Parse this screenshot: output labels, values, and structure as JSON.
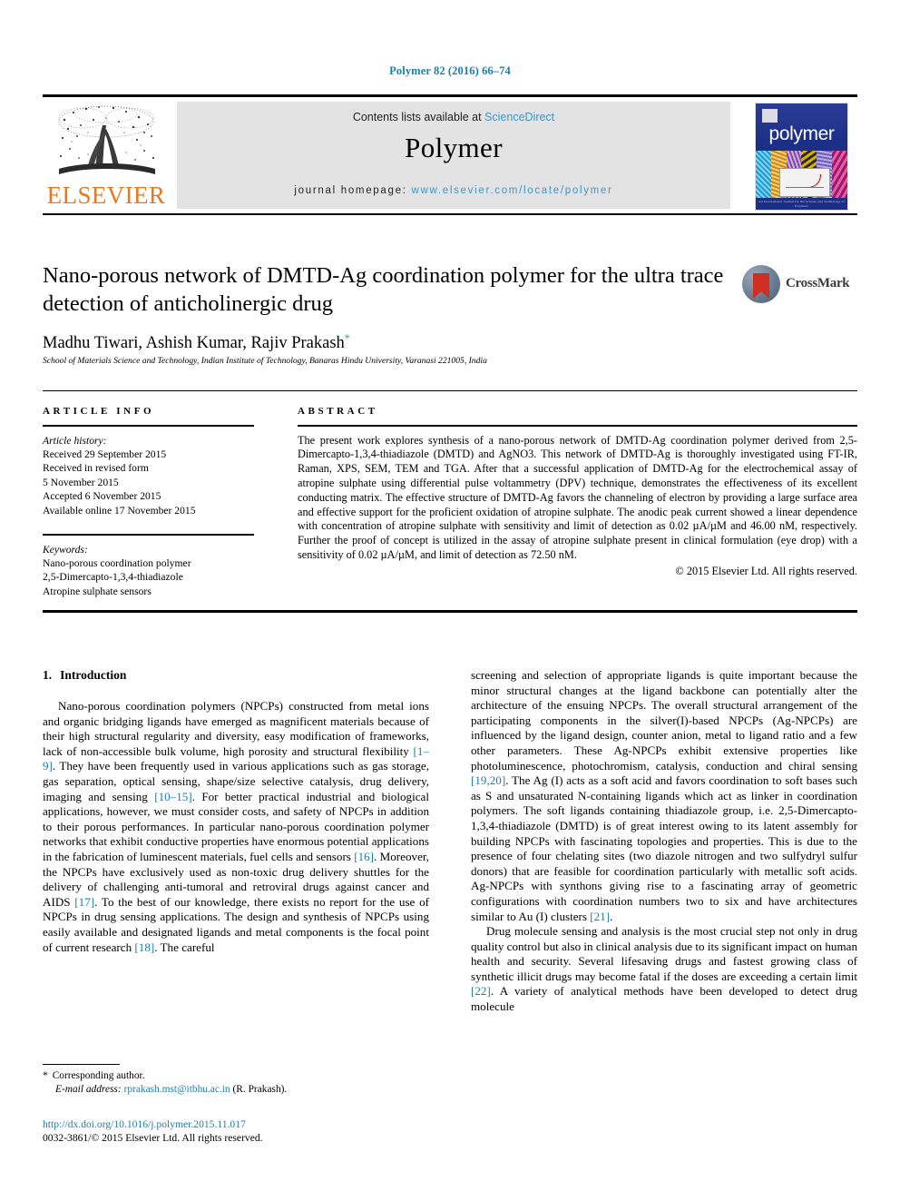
{
  "running_head": "Polymer 82 (2016) 66–74",
  "masthead": {
    "publisher_name": "ELSEVIER",
    "contents_prefix": "Contents lists available at ",
    "contents_link": "ScienceDirect",
    "journal_name": "Polymer",
    "homepage_prefix": "journal homepage: ",
    "homepage_url": "www.elsevier.com/locate/polymer",
    "cover_title": "polymer",
    "cover_footer": "An International Journal for the\nScience and Technology of Polymers"
  },
  "article": {
    "title": "Nano-porous network of DMTD-Ag coordination polymer for the ultra trace detection of anticholinergic drug",
    "authors": "Madhu Tiwari, Ashish Kumar, Rajiv Prakash",
    "author_star": "*",
    "affiliation": "School of Materials Science and Technology, Indian Institute of Technology, Banaras Hindu University, Varanasi 221005, India",
    "crossmark_label": "CrossMark"
  },
  "article_info": {
    "heading": "ARTICLE INFO",
    "history_label": "Article history:",
    "history": [
      "Received 29 September 2015",
      "Received in revised form",
      "5 November 2015",
      "Accepted 6 November 2015",
      "Available online 17 November 2015"
    ],
    "keywords_label": "Keywords:",
    "keywords": [
      "Nano-porous coordination polymer",
      "2,5-Dimercapto-1,3,4-thiadiazole",
      "Atropine sulphate sensors"
    ]
  },
  "abstract": {
    "heading": "ABSTRACT",
    "text": "The present work explores synthesis of a nano-porous network of DMTD-Ag coordination polymer derived from 2,5-Dimercapto-1,3,4-thiadiazole (DMTD) and AgNO3. This network of DMTD-Ag is thoroughly investigated using FT-IR, Raman, XPS, SEM, TEM and TGA. After that a successful application of DMTD-Ag for the electrochemical assay of atropine sulphate using differential pulse voltammetry (DPV) technique, demonstrates the effectiveness of its excellent conducting matrix. The effective structure of DMTD-Ag favors the channeling of electron by providing a large surface area and effective support for the proficient oxidation of atropine sulphate. The anodic peak current showed a linear dependence with concentration of atropine sulphate with sensitivity and limit of detection as 0.02 µA/µM and 46.00 nM, respectively. Further the proof of concept is utilized in the assay of atropine sulphate present in clinical formulation (eye drop) with a sensitivity of 0.02 µA/µM, and limit of detection as 72.50 nM.",
    "copyright": "© 2015 Elsevier Ltd. All rights reserved."
  },
  "body": {
    "section_number": "1.",
    "section_title": "Introduction",
    "left_paragraph_1": "Nano-porous coordination polymers (NPCPs) constructed from metal ions and organic bridging ligands have emerged as magnificent materials because of their high structural regularity and diversity, easy modification of frameworks, lack of non-accessible bulk volume, high porosity and structural flexibility ",
    "left_ref_1": "[1–9]",
    "left_paragraph_1b": ". They have been frequently used in various applications such as gas storage, gas separation, optical sensing, shape/size selective catalysis, drug delivery, imaging and sensing ",
    "left_ref_2": "[10–15]",
    "left_paragraph_1c": ". For better practical industrial and biological applications, however, we must consider costs, and safety of NPCPs in addition to their porous performances. In particular nano-porous coordination polymer networks that exhibit conductive properties have enormous potential applications in the fabrication of luminescent materials, fuel cells and sensors ",
    "left_ref_3": "[16]",
    "left_paragraph_1d": ". Moreover, the NPCPs have exclusively used as non-toxic drug delivery shuttles for the delivery of challenging anti-tumoral and retroviral drugs against cancer and AIDS ",
    "left_ref_4": "[17]",
    "left_paragraph_1e": ". To the best of our knowledge, there exists no report for the use of NPCPs in drug sensing applications. The design and synthesis of NPCPs using easily available and designated ligands and metal components is the focal point of current research ",
    "left_ref_5": "[18]",
    "left_paragraph_1f": ". The careful",
    "right_paragraph_1": "screening and selection of appropriate ligands is quite important because the minor structural changes at the ligand backbone can potentially alter the architecture of the ensuing NPCPs. The overall structural arrangement of the participating components in the silver(I)-based NPCPs (Ag-NPCPs) are influenced by the ligand design, counter anion, metal to ligand ratio and a few other parameters. These Ag-NPCPs exhibit extensive properties like photoluminescence, photochromism, catalysis, conduction and chiral sensing ",
    "right_ref_1": "[19,20]",
    "right_paragraph_1b": ". The Ag (I) acts as a soft acid and favors coordination to soft bases such as S and unsaturated N-containing ligands which act as linker in coordination polymers. The soft ligands containing thiadiazole group, i.e. 2,5-Dimercapto-1,3,4-thiadiazole (DMTD) is of great interest owing to its latent assembly for building NPCPs with fascinating topologies and properties. This is due to the presence of four chelating sites (two diazole nitrogen and two sulfydryl sulfur donors) that are feasible for coordination particularly with metallic soft acids. Ag-NPCPs with synthons giving rise to a fascinating array of geometric configurations with coordination numbers two to six and have architectures similar to Au (I) clusters ",
    "right_ref_2": "[21]",
    "right_paragraph_1c": ".",
    "right_paragraph_2": "Drug molecule sensing and analysis is the most crucial step not only in drug quality control but also in clinical analysis due to its significant impact on human health and security. Several lifesaving drugs and fastest growing class of synthetic illicit drugs may become fatal if the doses are exceeding a certain limit ",
    "right_ref_3": "[22]",
    "right_paragraph_2b": ". A variety of analytical methods have been developed to detect drug molecule"
  },
  "footer": {
    "corresponding_star": "*",
    "corresponding_label": "Corresponding author.",
    "email_label": "E-mail address:",
    "email": "rprakash.mst@itbhu.ac.in",
    "email_suffix": "(R. Prakash).",
    "doi": "http://dx.doi.org/10.1016/j.polymer.2015.11.017",
    "issn_line": "0032-3861/© 2015 Elsevier Ltd. All rights reserved."
  },
  "colors": {
    "link_blue": "#1a7fad",
    "masthead_link": "#3f97c9",
    "elsevier_orange": "#E87722",
    "cover_blue": "#1c2f86",
    "crossmark_red": "#cf2e20"
  }
}
